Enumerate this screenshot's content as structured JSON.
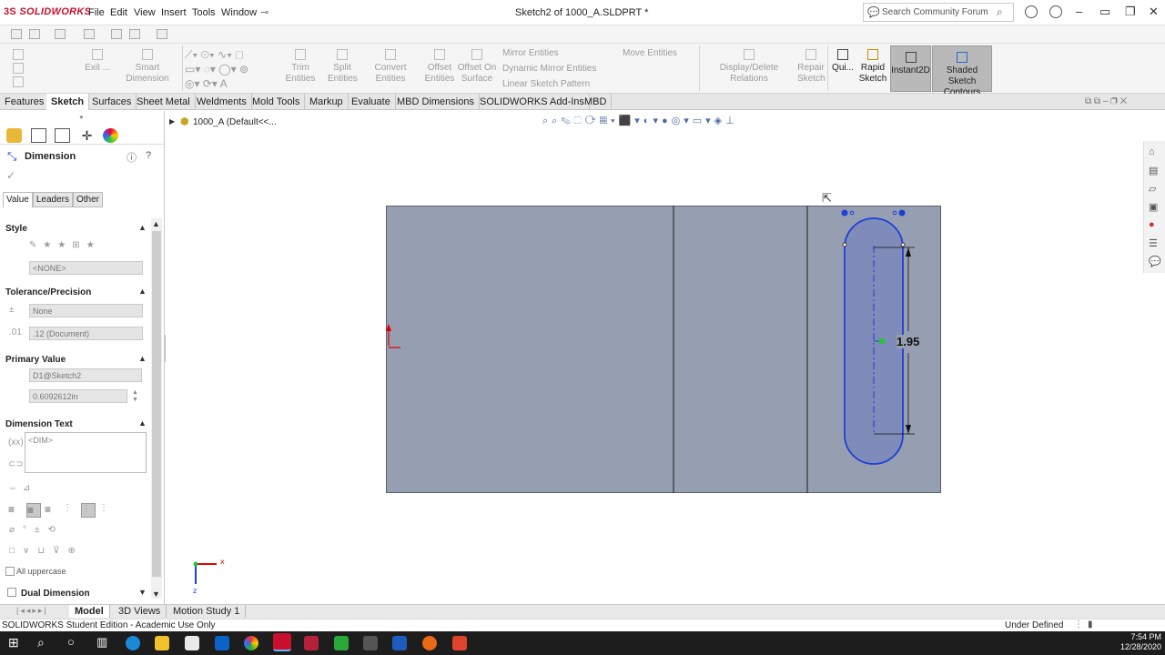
{
  "app": {
    "logo": "SOLIDWORKS",
    "doc_title": "Sketch2 of 1000_A.SLDPRT *",
    "search_placeholder": "Search Community Forum"
  },
  "menu": [
    "File",
    "Edit",
    "View",
    "Insert",
    "Tools",
    "Window"
  ],
  "ribbon": {
    "exit": "Exit ...",
    "smart_dim": "Smart Dimension",
    "trim": "Trim Entities",
    "split": "Split Entities",
    "convert": "Convert Entities",
    "offset": "Offset Entities",
    "offset_surface": "Offset On Surface",
    "mirror": "Mirror Entities",
    "dyn_mirror": "Dynamic Mirror Entities",
    "linear_pattern": "Linear Sketch Pattern",
    "move": "Move Entities",
    "display_delete": "Display/Delete Relations",
    "repair": "Repair Sketch",
    "quick": "Qui...",
    "rapid": "Rapid Sketch",
    "instant": "Instant2D",
    "shaded": "Shaded Sketch Contours"
  },
  "tabs": [
    "Features",
    "Sketch",
    "Surfaces",
    "Sheet Metal",
    "Weldments",
    "Mold Tools",
    "Markup",
    "Evaluate",
    "MBD Dimensions",
    "SOLIDWORKS Add-Ins",
    "MBD"
  ],
  "tree": {
    "root": "1000_A  (Default<<..."
  },
  "pm": {
    "title": "Dimension",
    "subtabs": [
      "Value",
      "Leaders",
      "Other"
    ],
    "style": "Style",
    "style_val": "<NONE>",
    "tol": "Tolerance/Precision",
    "tol_val": "None",
    "prec_val": ".12 (Document)",
    "primary": "Primary Value",
    "pv_name": "D1@Sketch2",
    "pv_value": "0.6092612in",
    "dimtext": "Dimension Text",
    "dim_tag": "<DIM>",
    "uppercase": "All uppercase",
    "dual": "Dual Dimension"
  },
  "sketch": {
    "dim_value": "1.95"
  },
  "bottom_tabs": [
    "Model",
    "3D Views",
    "Motion Study 1"
  ],
  "status": {
    "left": "SOLIDWORKS Student Edition - Academic Use Only",
    "right": "Under Defined"
  },
  "clock": {
    "time": "7:54 PM",
    "date": "12/28/2020"
  },
  "colors": {
    "accent_blue": "#1e3fd6",
    "part_fill": "#969eb1",
    "red_axis": "#e00000"
  }
}
